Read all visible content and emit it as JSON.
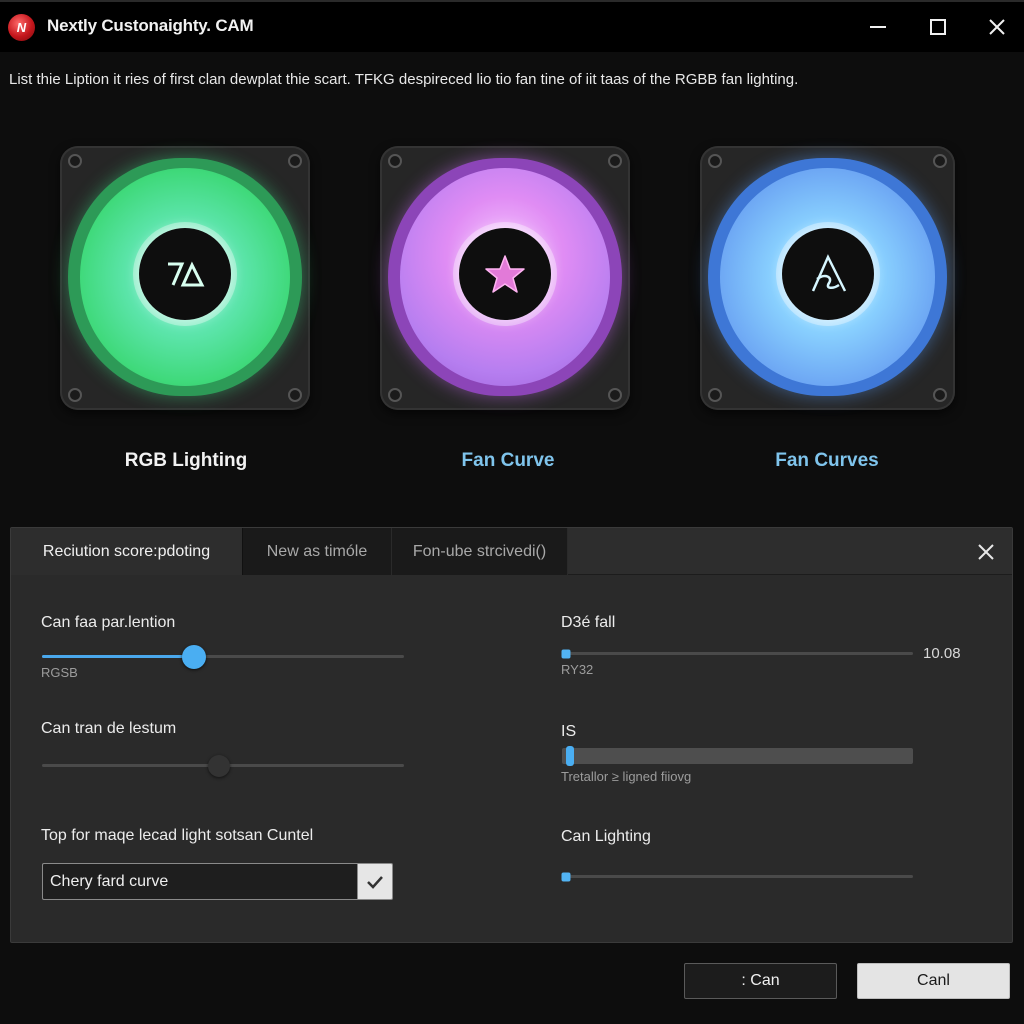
{
  "window": {
    "title": "Nextly Custonaighty. CAM",
    "app_icon_glyph": "N",
    "controls": {
      "minimize": "minimize-icon",
      "maximize": "maximize-icon",
      "close": "close-icon"
    }
  },
  "instruction": "List thie Liption it ries of first clan dewplat thie scart. TFKG despireced lio tio fan tine of iit taas of the RGBB fan lighting.",
  "fans": [
    {
      "label": "RGB Lighting",
      "color": "#3fd97a",
      "hub_logo": "7A"
    },
    {
      "label": "Fan Curve",
      "color": "#d98cf4",
      "hub_logo": "star"
    },
    {
      "label": "Fan Curves",
      "color": "#6ea8f4",
      "hub_logo": "A"
    }
  ],
  "panel": {
    "tabs": [
      {
        "label": "Reciution score:pdoting",
        "active": true
      },
      {
        "label": "New as timóle",
        "active": false
      },
      {
        "label": "Fon-ube strcivedi()",
        "active": false
      }
    ],
    "close_icon": "close-icon",
    "left": {
      "slider1": {
        "label": "Can faa par.lention",
        "sublabel": "RGSB",
        "value_fraction": 0.42
      },
      "slider2": {
        "label": "Can tran de lestum",
        "value_fraction": 0.49
      },
      "dropdown": {
        "label": "Top for maqe lecad light sotsan Cuntel",
        "value": "Chery fard curve",
        "confirm_icon": "checkmark-icon"
      }
    },
    "right": {
      "slider1": {
        "label": "D3é fall",
        "sublabel": "RY32",
        "value": "10.08",
        "value_fraction": 0.01
      },
      "bar": {
        "label": "IS",
        "sublabel": "Tretallor ≥ ligned fiiovg",
        "value_fraction": 0.01
      },
      "slider2": {
        "label": "Can Lighting",
        "value_fraction": 0.01
      }
    }
  },
  "footer": {
    "secondary_button": ": Can",
    "primary_button": "Canl"
  },
  "accent_color": "#4aaef2"
}
